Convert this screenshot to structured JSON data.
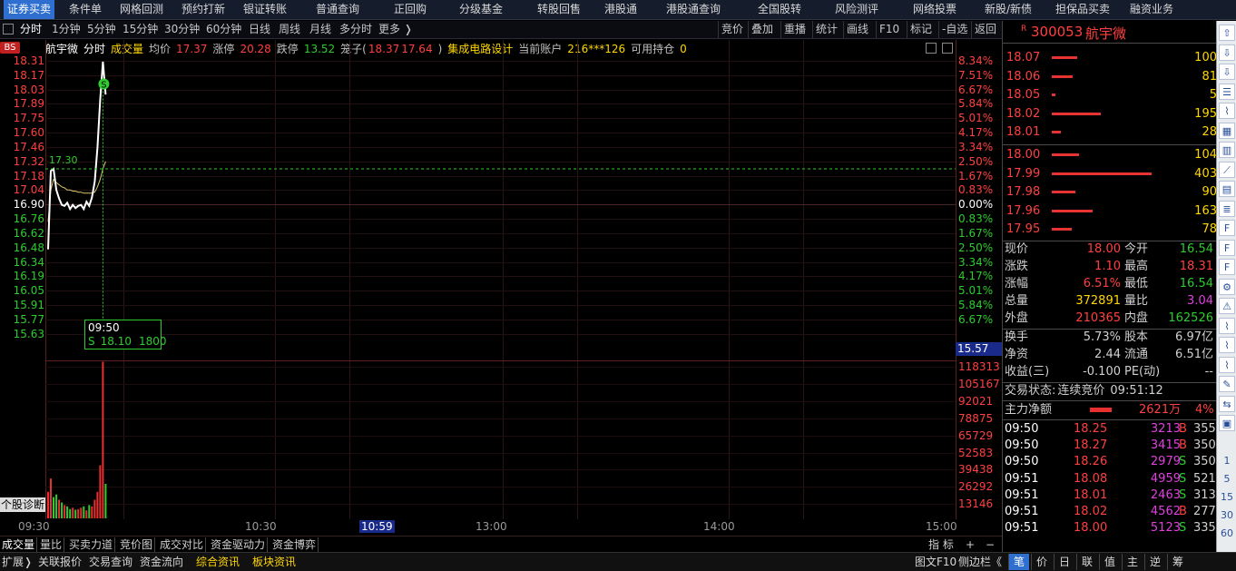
{
  "top_nav": [
    "证券买卖",
    "条件单",
    "网格回测",
    "预约打新",
    "银证转账",
    "普通查询",
    "正回购",
    "分级基金",
    "转股回售",
    "港股通",
    "港股通查询",
    "全国股转",
    "风险测评",
    "网络投票",
    "新股/新债",
    "担保品买卖",
    "融资业务"
  ],
  "period_tabs": [
    "分时",
    "1分钟",
    "5分钟",
    "15分钟",
    "30分钟",
    "60分钟",
    "日线",
    "周线",
    "月线",
    "多分时",
    "更多 ❭"
  ],
  "right_tools": [
    "竞价",
    "叠加",
    "重播",
    "统计",
    "画线",
    "F10",
    "标记",
    "-自选",
    "返回"
  ],
  "info": {
    "name": "航宇微",
    "mode": "分时",
    "vol_label": "成交量",
    "avg_label": "均价",
    "avg": "17.37",
    "up_label": "涨停",
    "up": "20.28",
    "down_label": "跌停",
    "down": "13.52",
    "cage_label": "笼子(",
    "cage_lo": "18.37",
    "cage_hi": "17.64",
    "cage_end": ")",
    "industry": "集成电路设计",
    "account_label": "当前账户",
    "account": "216***126",
    "avail_label": "可用持仓",
    "avail": "0"
  },
  "bs_tag": "BS",
  "price_labels": [
    "18.31",
    "18.17",
    "18.03",
    "17.89",
    "17.75",
    "17.60",
    "17.46",
    "17.32",
    "17.18",
    "17.04",
    "16.90",
    "16.76",
    "16.62",
    "16.48",
    "16.34",
    "16.19",
    "16.05",
    "15.91",
    "15.77",
    "15.63"
  ],
  "pct_labels": [
    "8.34%",
    "7.51%",
    "6.67%",
    "5.84%",
    "5.01%",
    "4.17%",
    "3.34%",
    "2.50%",
    "1.67%",
    "0.83%",
    "0.00%",
    "0.83%",
    "1.67%",
    "2.50%",
    "3.34%",
    "4.17%",
    "5.01%",
    "5.84%",
    "6.67%"
  ],
  "price_low_box": "15.57",
  "vol_labels": [
    "118313",
    "105167",
    "92021",
    "78875",
    "65729",
    "52583",
    "39438",
    "26292",
    "13146"
  ],
  "price_marker": "17.30",
  "time_labels": [
    "09:30",
    "10:30",
    "10:59",
    "13:00",
    "14:00",
    "15:00"
  ],
  "tooltip": {
    "time": "09:50",
    "side": "S",
    "price": "18.10",
    "vol": "1800"
  },
  "diag_label": "个股诊断",
  "bottom_tabs": [
    "成交量",
    "量比",
    "买卖力道",
    "竞价图",
    "成交对比",
    "资金驱动力",
    "资金博弈"
  ],
  "bottom_right": [
    "指 标",
    "+",
    "−"
  ],
  "bottom2": [
    "扩展❭",
    "关联报价",
    "交易查询",
    "资金流向",
    "综合资讯",
    "板块资讯",
    "图文F10",
    "侧边栏《"
  ],
  "bottom2_right": [
    "笔",
    "价",
    "日",
    "联",
    "值",
    "主",
    "逆",
    "筹"
  ],
  "stock": {
    "flag": "R",
    "code": "300053",
    "name": "航宇微"
  },
  "asks": [
    {
      "p": "18.07",
      "v": "100",
      "w": 28
    },
    {
      "p": "18.06",
      "v": "81",
      "w": 23
    },
    {
      "p": "18.05",
      "v": "5",
      "w": 4
    },
    {
      "p": "18.02",
      "v": "195",
      "w": 54
    },
    {
      "p": "18.01",
      "v": "28",
      "w": 10
    }
  ],
  "bids": [
    {
      "p": "18.00",
      "v": "104",
      "w": 30
    },
    {
      "p": "17.99",
      "v": "403",
      "w": 110
    },
    {
      "p": "17.98",
      "v": "90",
      "w": 26
    },
    {
      "p": "17.96",
      "v": "163",
      "w": 45
    },
    {
      "p": "17.95",
      "v": "78",
      "w": 22
    }
  ],
  "quote": [
    {
      "k1": "现价",
      "v1": "18.00",
      "c1": "#ff4040",
      "k2": "今开",
      "v2": "16.54",
      "c2": "#2ecc2e"
    },
    {
      "k1": "涨跌",
      "v1": "1.10",
      "c1": "#ff4040",
      "k2": "最高",
      "v2": "18.31",
      "c2": "#ff4040"
    },
    {
      "k1": "涨幅",
      "v1": "6.51%",
      "c1": "#ff4040",
      "k2": "最低",
      "v2": "16.54",
      "c2": "#2ecc2e"
    },
    {
      "k1": "总量",
      "v1": "372891",
      "c1": "#ffd700",
      "k2": "量比",
      "v2": "3.04",
      "c2": "#e040e0"
    },
    {
      "k1": "外盘",
      "v1": "210365",
      "c1": "#ff4040",
      "k2": "内盘",
      "v2": "162526",
      "c2": "#2ecc2e"
    }
  ],
  "quote2": [
    {
      "k1": "换手",
      "v1": "5.73%",
      "c1": "#d0d0d0",
      "k2": "股本",
      "v2": "6.97亿",
      "c2": "#d0d0d0"
    },
    {
      "k1": "净资",
      "v1": "2.44",
      "c1": "#d0d0d0",
      "k2": "流通",
      "v2": "6.51亿",
      "c2": "#d0d0d0"
    },
    {
      "k1": "收益(三)",
      "v1": "-0.100",
      "c1": "#d0d0d0",
      "k2": "PE(动)",
      "v2": "--",
      "c2": "#d0d0d0"
    }
  ],
  "status": {
    "label": "交易状态:",
    "value": "连续竞价",
    "time": "09:51:12"
  },
  "mainflow": {
    "label": "主力净额",
    "value": "2621万",
    "pct": "4%"
  },
  "trades": [
    {
      "t": "09:50",
      "p": "18.25",
      "v": "3213",
      "s": "B",
      "n": "355"
    },
    {
      "t": "09:50",
      "p": "18.27",
      "v": "3415",
      "s": "B",
      "n": "350"
    },
    {
      "t": "09:50",
      "p": "18.26",
      "v": "2979",
      "s": "S",
      "n": "350"
    },
    {
      "t": "09:51",
      "p": "18.08",
      "v": "4959",
      "s": "S",
      "n": "521"
    },
    {
      "t": "09:51",
      "p": "18.01",
      "v": "2463",
      "s": "S",
      "n": "313"
    },
    {
      "t": "09:51",
      "p": "18.02",
      "v": "4562",
      "s": "B",
      "n": "277"
    },
    {
      "t": "09:51",
      "p": "18.00",
      "v": "5123",
      "s": "S",
      "n": "335"
    }
  ],
  "sidebar_icons": [
    "up-arrow",
    "down-arrow",
    "down-arrow",
    "list",
    "chart",
    "grid",
    "candle",
    "line",
    "table",
    "report",
    "f10",
    "f9",
    "f8",
    "gear",
    "alert",
    "chart2",
    "chart3",
    "chart4",
    "edit",
    "link",
    "n1",
    "n5",
    "n15",
    "n30",
    "n60"
  ],
  "sidebar_nums": [
    "1",
    "5",
    "15",
    "30",
    "60"
  ],
  "colors": {
    "up": "#ff4040",
    "down": "#2ecc2e",
    "bg": "#000000",
    "grid": "#2a1515",
    "yellow": "#ffd700",
    "accent": "#2f6fd0"
  },
  "chart_data": {
    "type": "line",
    "x": [
      "09:30",
      "09:31",
      "09:32",
      "09:33",
      "09:34",
      "09:35",
      "09:36",
      "09:37",
      "09:38",
      "09:39",
      "09:40",
      "09:41",
      "09:42",
      "09:43",
      "09:44",
      "09:45",
      "09:46",
      "09:47",
      "09:48",
      "09:49",
      "09:50",
      "09:51"
    ],
    "price": [
      16.54,
      17.28,
      17.3,
      17.1,
      17.02,
      16.96,
      16.95,
      16.98,
      16.92,
      16.96,
      16.93,
      16.95,
      16.96,
      16.92,
      16.99,
      16.95,
      17.03,
      17.18,
      17.5,
      17.95,
      18.31,
      18.0
    ],
    "avg": [
      16.8,
      17.1,
      17.2,
      17.17,
      17.15,
      17.13,
      17.12,
      17.1,
      17.1,
      17.09,
      17.09,
      17.08,
      17.08,
      17.07,
      17.07,
      17.07,
      17.07,
      17.08,
      17.13,
      17.2,
      17.3,
      17.37
    ],
    "volume": [
      20000,
      30000,
      16000,
      18000,
      14000,
      12000,
      10000,
      9000,
      7000,
      8000,
      6500,
      7000,
      8000,
      9000,
      6000,
      10000,
      9000,
      14000,
      20000,
      40000,
      118000,
      26000
    ],
    "vol_up": [
      true,
      true,
      false,
      false,
      true,
      false,
      true,
      false,
      false,
      true,
      false,
      true,
      true,
      false,
      true,
      false,
      true,
      true,
      true,
      true,
      true,
      false
    ],
    "ylim": [
      15.63,
      18.31
    ],
    "vol_max": 118313
  }
}
